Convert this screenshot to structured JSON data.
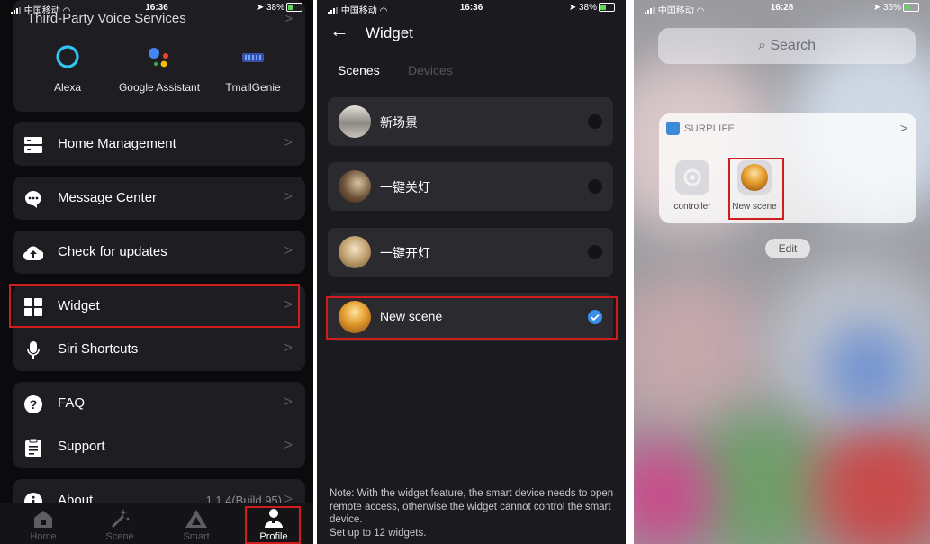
{
  "phone1": {
    "status": {
      "carrier": "中国移动",
      "time": "16:36",
      "battery": "38%"
    },
    "voice_title": "Third-Party Voice Services",
    "voice_assistants": [
      {
        "label": "Alexa",
        "icon": "alexa-icon"
      },
      {
        "label": "Google Assistant",
        "icon": "google-assistant-icon"
      },
      {
        "label": "TmallGenie",
        "icon": "tmall-genie-icon"
      }
    ],
    "menu": {
      "home_management": "Home Management",
      "message_center": "Message Center",
      "check_updates": "Check for updates",
      "widget": "Widget",
      "siri_shortcuts": "Siri Shortcuts",
      "faq": "FAQ",
      "support": "Support",
      "about": "About",
      "about_version": "1.1.4(Build 95)"
    },
    "tabs": {
      "home": "Home",
      "scene": "Scene",
      "smart": "Smart",
      "profile": "Profile"
    },
    "colors": {
      "highlight": "#d01c1c",
      "background": "#0b0b0d",
      "card": "#1d1d22"
    }
  },
  "phone2": {
    "status": {
      "carrier": "中国移动",
      "time": "16:36",
      "battery": "38%"
    },
    "title": "Widget",
    "tabs": {
      "scenes": "Scenes",
      "devices": "Devices"
    },
    "scenes": [
      {
        "name": "新场景",
        "selected": false
      },
      {
        "name": "一键关灯",
        "selected": false
      },
      {
        "name": "一键开灯",
        "selected": false
      },
      {
        "name": "New scene",
        "selected": true
      }
    ],
    "note": "Note: With the widget feature, the smart device needs to open remote access, otherwise the widget cannot control the smart device.",
    "note2": "Set up to 12 widgets.",
    "colors": {
      "accent": "#3a8ee6"
    }
  },
  "phone3": {
    "status": {
      "carrier": "中国移动",
      "time": "16:28",
      "battery": "36%"
    },
    "search_placeholder": "Search",
    "widget_title": "SURPLIFE",
    "items": [
      {
        "label": "controller",
        "icon": "controller-icon"
      },
      {
        "label": "New scene",
        "icon": "new-scene-icon"
      }
    ],
    "edit": "Edit"
  }
}
